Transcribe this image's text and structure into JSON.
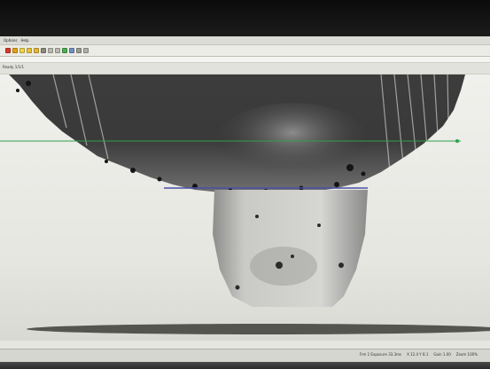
{
  "window": {
    "menu": [
      "Options",
      "Help"
    ],
    "toolbar_buttons": [
      {
        "icon": "stop-icon",
        "color": "#d8382c"
      },
      {
        "icon": "record-icon",
        "color": "#e2a313"
      },
      {
        "icon": "play-icon",
        "color": "#f0d24b"
      },
      {
        "icon": "snapshot-icon",
        "color": "#e8c23a"
      },
      {
        "icon": "contrast-icon",
        "color": "#e6b63a"
      },
      {
        "icon": "brightness-icon",
        "color": "#8a8a80"
      },
      {
        "icon": "zoom-in-icon",
        "color": "#b9b9b0"
      },
      {
        "icon": "zoom-out-icon",
        "color": "#b9b9b0"
      },
      {
        "icon": "grid-icon",
        "color": "#4caf50"
      },
      {
        "icon": "ruler-icon",
        "color": "#6f8fc2"
      },
      {
        "icon": "measure-icon",
        "color": "#9b9b92"
      },
      {
        "icon": "settings-icon",
        "color": "#b0b0a6"
      }
    ],
    "status_left": "Ready 1/1/1",
    "status_bar": [
      "Frm 1 Exposure 33.3ms",
      "X 12.4 Y 8.1",
      "Gain 1.00",
      "Zoom 100%"
    ]
  },
  "viewport": {
    "image_kind": "x-ray inspection of melt column",
    "colors": {
      "background": "#ecece8",
      "dark_mass": "#2d2d2d",
      "green_guide": "#2fa14b",
      "blue_guide": "#4a4fa8"
    }
  }
}
